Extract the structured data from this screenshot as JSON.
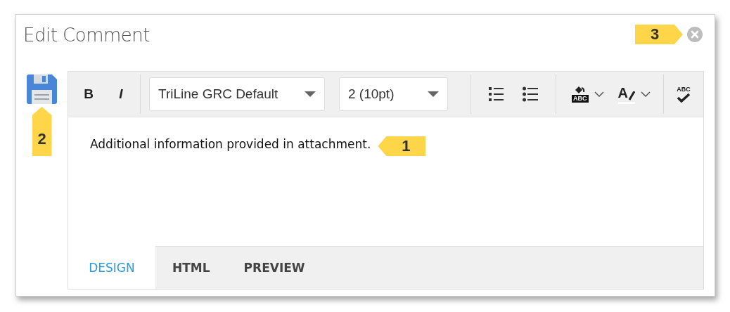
{
  "dialog": {
    "title": "Edit Comment"
  },
  "toolbar": {
    "items": [
      {
        "kind": "bold",
        "label": "B"
      },
      {
        "kind": "italic",
        "label": "I"
      },
      {
        "kind": "separator"
      },
      {
        "kind": "fontname",
        "value": "TriLine GRC Default"
      },
      {
        "kind": "fontsize",
        "value": "2 (10pt)"
      },
      {
        "kind": "separator"
      },
      {
        "kind": "numbered-list"
      },
      {
        "kind": "bulleted-list"
      },
      {
        "kind": "separator"
      },
      {
        "kind": "background-color",
        "label": "ABC"
      },
      {
        "kind": "chevron"
      },
      {
        "kind": "font-color",
        "label": "A"
      },
      {
        "kind": "chevron"
      },
      {
        "kind": "separator"
      },
      {
        "kind": "spellcheck",
        "label": "ABC"
      }
    ]
  },
  "content": "Additional information provided in attachment.",
  "tabs": [
    {
      "label": "DESIGN",
      "selected": true
    },
    {
      "label": "HTML",
      "selected": false
    },
    {
      "label": "PREVIEW",
      "selected": false
    }
  ],
  "callouts": [
    {
      "number": "1",
      "kind": "left"
    },
    {
      "number": "2",
      "kind": "up"
    },
    {
      "number": "3",
      "kind": "right"
    }
  ]
}
